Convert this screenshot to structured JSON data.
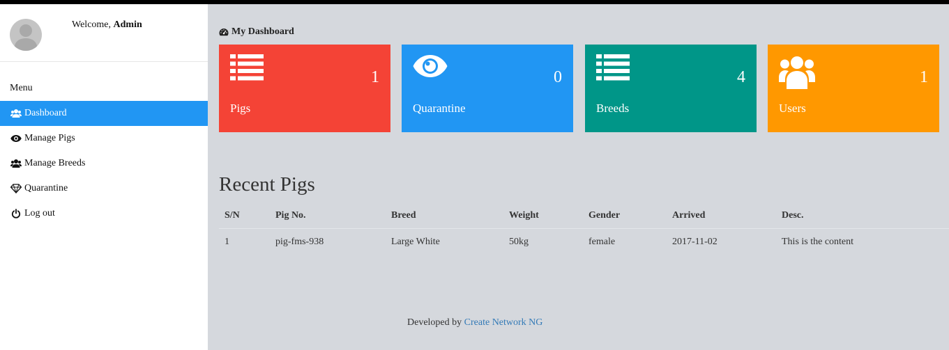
{
  "sidebar": {
    "welcome_prefix": "Welcome,",
    "welcome_user": "Admin",
    "menu_label": "Menu",
    "items": [
      {
        "label": "Dashboard",
        "icon": "users-icon",
        "active": true
      },
      {
        "label": "Manage Pigs",
        "icon": "eye-icon"
      },
      {
        "label": "Manage Breeds",
        "icon": "users-icon"
      },
      {
        "label": "Quarantine",
        "icon": "diamond-icon"
      },
      {
        "label": "Log out",
        "icon": "power-icon"
      }
    ]
  },
  "main": {
    "title": "My Dashboard",
    "cards": [
      {
        "label": "Pigs",
        "count": "1",
        "color": "#f44336",
        "icon": "list-icon"
      },
      {
        "label": "Quarantine",
        "count": "0",
        "color": "#2196f3",
        "icon": "eye-icon"
      },
      {
        "label": "Breeds",
        "count": "4",
        "color": "#009688",
        "icon": "list-icon"
      },
      {
        "label": "Users",
        "count": "1",
        "color": "#ff9800",
        "icon": "users-icon"
      }
    ],
    "recent_title": "Recent Pigs",
    "table": {
      "headers": [
        "S/N",
        "Pig No.",
        "Breed",
        "Weight",
        "Gender",
        "Arrived",
        "Desc."
      ],
      "rows": [
        [
          "1",
          "pig-fms-938",
          "Large White",
          "50kg",
          "female",
          "2017-11-02",
          "This is the content"
        ]
      ]
    }
  },
  "footer": {
    "prefix": "Developed by",
    "link": "Create Network NG"
  }
}
